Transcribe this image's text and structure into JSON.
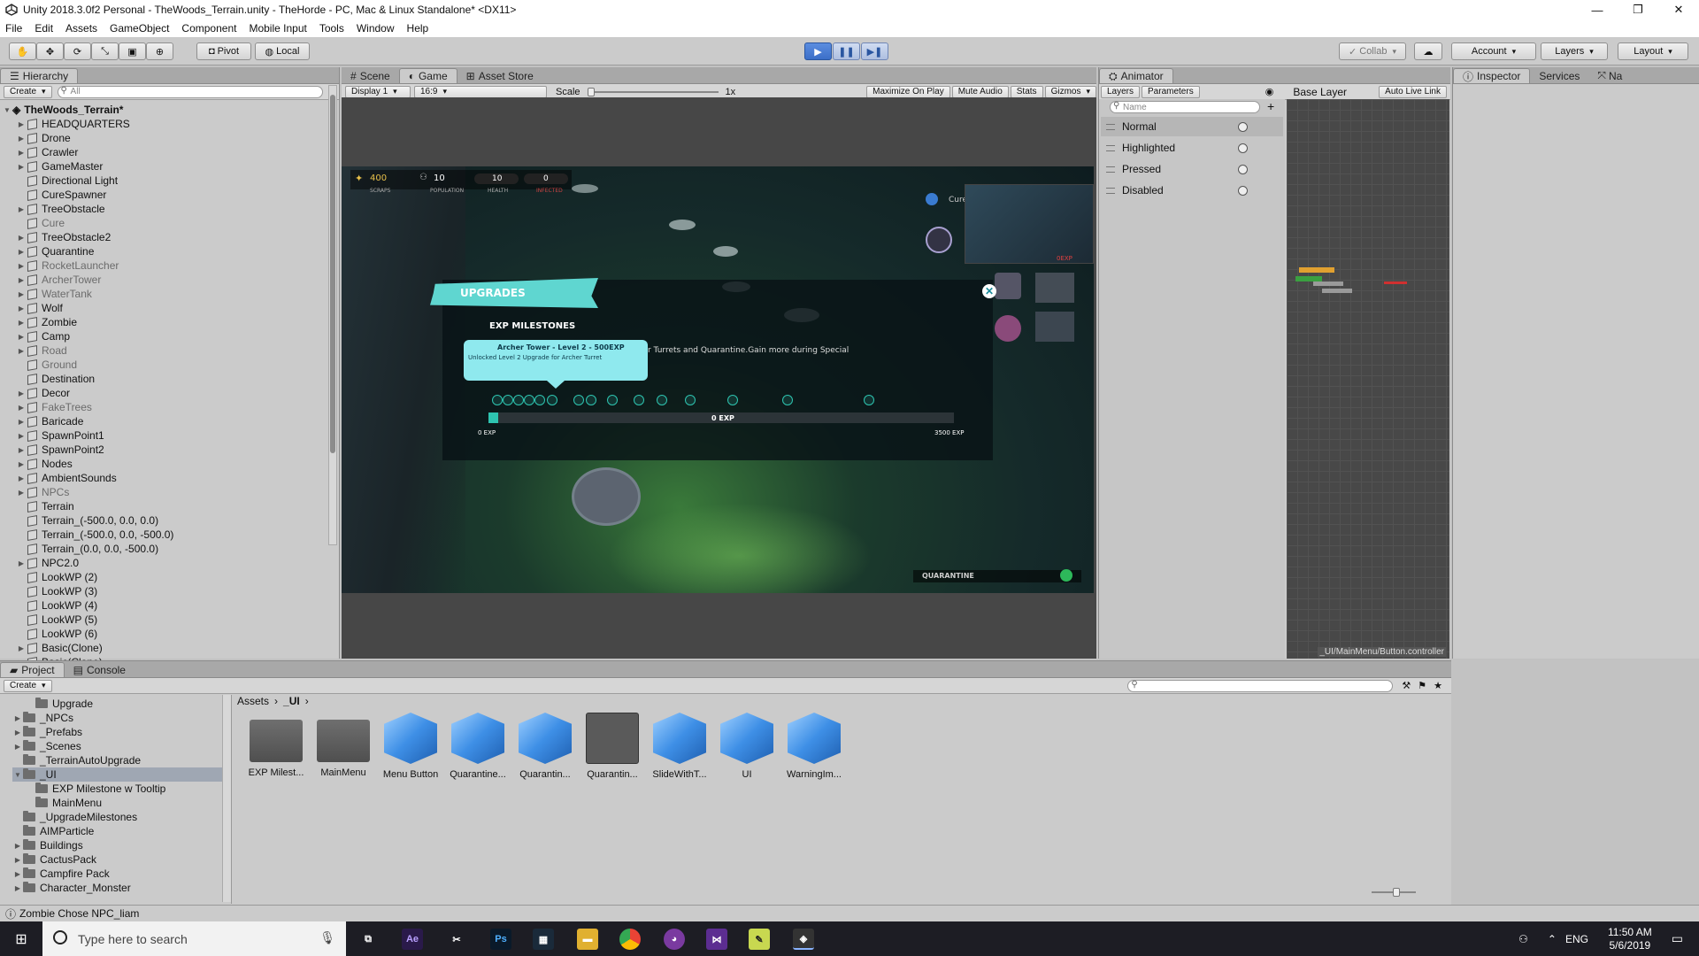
{
  "window": {
    "title": "Unity 2018.3.0f2 Personal - TheWoods_Terrain.unity - TheHorde - PC, Mac & Linux Standalone* <DX11>",
    "controls": [
      "—",
      "❐",
      "✕"
    ]
  },
  "menu": [
    "File",
    "Edit",
    "Assets",
    "GameObject",
    "Component",
    "Mobile Input",
    "Tools",
    "Window",
    "Help"
  ],
  "toolbar": {
    "pivot": "Pivot",
    "local": "Local",
    "collab": "Collab",
    "account": "Account",
    "layers": "Layers",
    "layout": "Layout"
  },
  "hierarchy": {
    "tab": "Hierarchy",
    "create": "Create",
    "search_placeholder": "All",
    "scene": "TheWoods_Terrain*",
    "items": [
      {
        "name": "HEADQUARTERS",
        "arrow": true,
        "grey": false
      },
      {
        "name": "Drone",
        "arrow": true,
        "grey": false
      },
      {
        "name": "Crawler",
        "arrow": true,
        "grey": false
      },
      {
        "name": "GameMaster",
        "arrow": true,
        "grey": false
      },
      {
        "name": "Directional Light",
        "arrow": false,
        "grey": false
      },
      {
        "name": "CureSpawner",
        "arrow": false,
        "grey": false
      },
      {
        "name": "TreeObstacle",
        "arrow": true,
        "grey": false
      },
      {
        "name": "Cure",
        "arrow": false,
        "grey": true
      },
      {
        "name": "TreeObstacle2",
        "arrow": true,
        "grey": false
      },
      {
        "name": "Quarantine",
        "arrow": true,
        "grey": false
      },
      {
        "name": "RocketLauncher",
        "arrow": true,
        "grey": true
      },
      {
        "name": "ArcherTower",
        "arrow": true,
        "grey": true
      },
      {
        "name": "WaterTank",
        "arrow": true,
        "grey": true
      },
      {
        "name": "Wolf",
        "arrow": true,
        "grey": false
      },
      {
        "name": "Zombie",
        "arrow": true,
        "grey": false
      },
      {
        "name": "Camp",
        "arrow": true,
        "grey": false
      },
      {
        "name": "Road",
        "arrow": true,
        "grey": true
      },
      {
        "name": "Ground",
        "arrow": false,
        "grey": true
      },
      {
        "name": "Destination",
        "arrow": false,
        "grey": false
      },
      {
        "name": "Decor",
        "arrow": true,
        "grey": false
      },
      {
        "name": "FakeTrees",
        "arrow": true,
        "grey": true
      },
      {
        "name": "Baricade",
        "arrow": true,
        "grey": false
      },
      {
        "name": "SpawnPoint1",
        "arrow": true,
        "grey": false
      },
      {
        "name": "SpawnPoint2",
        "arrow": true,
        "grey": false
      },
      {
        "name": "Nodes",
        "arrow": true,
        "grey": false
      },
      {
        "name": "AmbientSounds",
        "arrow": true,
        "grey": false
      },
      {
        "name": "NPCs",
        "arrow": true,
        "grey": true
      },
      {
        "name": "Terrain",
        "arrow": false,
        "grey": false
      },
      {
        "name": "Terrain_(-500.0, 0.0, 0.0)",
        "arrow": false,
        "grey": false
      },
      {
        "name": "Terrain_(-500.0, 0.0, -500.0)",
        "arrow": false,
        "grey": false
      },
      {
        "name": "Terrain_(0.0, 0.0, -500.0)",
        "arrow": false,
        "grey": false
      },
      {
        "name": "NPC2.0",
        "arrow": true,
        "grey": false
      },
      {
        "name": "LookWP (2)",
        "arrow": false,
        "grey": false
      },
      {
        "name": "LookWP (3)",
        "arrow": false,
        "grey": false
      },
      {
        "name": "LookWP (4)",
        "arrow": false,
        "grey": false
      },
      {
        "name": "LookWP (5)",
        "arrow": false,
        "grey": false
      },
      {
        "name": "LookWP (6)",
        "arrow": false,
        "grey": false
      },
      {
        "name": "Basic(Clone)",
        "arrow": true,
        "grey": false
      },
      {
        "name": "Basic(Clone)",
        "arrow": true,
        "grey": false
      }
    ]
  },
  "scene_tabs": {
    "scene": "Scene",
    "game": "Game",
    "store": "Asset Store"
  },
  "game": {
    "display": "Display 1",
    "aspect": "16:9",
    "scale_label": "Scale",
    "scale_value": "1x",
    "buttons": [
      "Maximize On Play",
      "Mute Audio",
      "Stats",
      "Gizmos"
    ],
    "hud": {
      "scraps": "400",
      "scraps_label": "SCRAPS",
      "population": "10",
      "population_label": "POPULATION",
      "health": "10",
      "health_label": "HEALTH",
      "infected": "0",
      "infected_label": "INFECTED"
    },
    "upgrades_title": "UPGRADES",
    "milestones_title": "EXP MILESTONES",
    "milestones_desc": "r Turrets and Quarantine.Gain more during Special",
    "tooltip_title": "Archer Tower - Level 2 - 500EXP",
    "tooltip_desc": "Unlocked Level 2 Upgrade for Archer Turret",
    "exp_current": "0 EXP",
    "exp_min": "0 EXP",
    "exp_max": "3500 EXP",
    "exp_progress": 0.02,
    "cure_label": "Cure",
    "quarantine_label": "QUARANTINE",
    "portrait_exp": "0EXP"
  },
  "animator": {
    "tab": "Animator",
    "layers_tab": "Layers",
    "params_tab": "Parameters",
    "search_placeholder": "Name",
    "base_layer": "Base Layer",
    "auto_live": "Auto Live Link",
    "states": [
      "Normal",
      "Highlighted",
      "Pressed",
      "Disabled"
    ],
    "controller_path": "_UI/MainMenu/Button.controller"
  },
  "inspector": {
    "tab": "Inspector",
    "services": "Services",
    "nav": "Na"
  },
  "project": {
    "tab": "Project",
    "console": "Console",
    "create": "Create",
    "breadcrumb": [
      "Assets",
      "_UI"
    ],
    "tree": [
      {
        "name": "Upgrade",
        "indent": 2,
        "arrow": false
      },
      {
        "name": "_NPCs",
        "indent": 1,
        "arrow": true
      },
      {
        "name": "_Prefabs",
        "indent": 1,
        "arrow": true
      },
      {
        "name": "_Scenes",
        "indent": 1,
        "arrow": true
      },
      {
        "name": "_TerrainAutoUpgrade",
        "indent": 1,
        "arrow": false
      },
      {
        "name": "_UI",
        "indent": 1,
        "arrow": true,
        "selected": true
      },
      {
        "name": "EXP Milestone w Tooltip",
        "indent": 2,
        "arrow": false
      },
      {
        "name": "MainMenu",
        "indent": 2,
        "arrow": false
      },
      {
        "name": "_UpgradeMilestones",
        "indent": 1,
        "arrow": false
      },
      {
        "name": "AIMParticle",
        "indent": 1,
        "arrow": false
      },
      {
        "name": "Buildings",
        "indent": 1,
        "arrow": true
      },
      {
        "name": "CactusPack",
        "indent": 1,
        "arrow": true
      },
      {
        "name": "Campfire Pack",
        "indent": 1,
        "arrow": true
      },
      {
        "name": "Character_Monster",
        "indent": 1,
        "arrow": true
      }
    ],
    "assets": [
      {
        "name": "EXP Milest...",
        "kind": "folder"
      },
      {
        "name": "MainMenu",
        "kind": "folder"
      },
      {
        "name": "Menu Button",
        "kind": "prefab"
      },
      {
        "name": "Quarantine...",
        "kind": "prefab"
      },
      {
        "name": "Quarantin...",
        "kind": "prefab"
      },
      {
        "name": "Quarantin...",
        "kind": "controller"
      },
      {
        "name": "SlideWithT...",
        "kind": "prefab"
      },
      {
        "name": "UI",
        "kind": "prefab"
      },
      {
        "name": "WarningIm...",
        "kind": "prefab"
      }
    ]
  },
  "status": {
    "text": "Zombie  Chose NPC_liam"
  },
  "taskbar": {
    "search": "Type here to search",
    "lang": "ENG",
    "time": "11:50 AM",
    "date": "5/6/2019"
  },
  "colors": {
    "teal": "#5fd6d0",
    "tooltip": "#8fe9ee",
    "play": "#3c6fc8"
  }
}
